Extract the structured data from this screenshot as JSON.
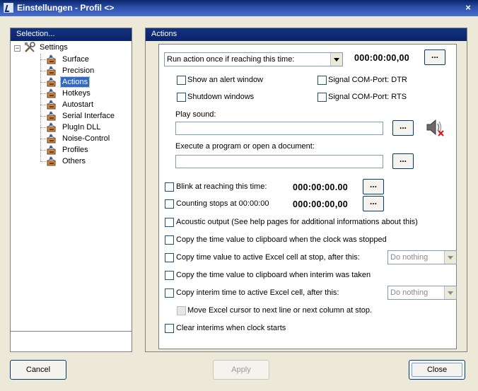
{
  "window": {
    "title": "Einstellungen - Profil <>",
    "close_glyph": "×"
  },
  "left_panel": {
    "header": "Selection...",
    "root": {
      "label": "Settings",
      "icon": "tools-icon",
      "expander": "−"
    },
    "items": [
      {
        "label": "Surface",
        "selected": false
      },
      {
        "label": "Precision",
        "selected": false
      },
      {
        "label": "Actions",
        "selected": true
      },
      {
        "label": "Hotkeys",
        "selected": false
      },
      {
        "label": "Autostart",
        "selected": false
      },
      {
        "label": "Serial Interface",
        "selected": false
      },
      {
        "label": "PlugIn DLL",
        "selected": false
      },
      {
        "label": "Noise-Control",
        "selected": false
      },
      {
        "label": "Profiles",
        "selected": false
      },
      {
        "label": "Others",
        "selected": false
      }
    ]
  },
  "right_panel": {
    "header": "Actions",
    "run_action": {
      "value": "Run action once if reaching this time:",
      "time": "000:00:00,00",
      "browse": "..."
    },
    "show_alert": {
      "label": "Show an alert window",
      "checked": false
    },
    "shutdown": {
      "label": "Shutdown windows",
      "checked": false
    },
    "signal_dtr": {
      "label": "Signal COM-Port: DTR",
      "checked": false
    },
    "signal_rts": {
      "label": "Signal COM-Port: RTS",
      "checked": false
    },
    "play_sound": {
      "label": "Play sound:",
      "value": "",
      "browse": "..."
    },
    "execute": {
      "label": "Execute a program or open a document:",
      "value": "",
      "browse": "..."
    },
    "blink": {
      "label": "Blink at reaching this time:",
      "time": "000:00:00.00",
      "browse": "..."
    },
    "counting_stops": {
      "label": "Counting stops at 00:00:00",
      "time": "000:00:00,00",
      "browse": "..."
    },
    "acoustic": {
      "label": "Acoustic output (See help pages for additional informations about this)"
    },
    "copy_clipboard_stop": {
      "label": "Copy the time value to clipboard when the clock was stopped"
    },
    "copy_excel_stop": {
      "label": "Copy time value to active Excel cell at stop, after this:",
      "select": "Do nothing"
    },
    "copy_clipboard_interim": {
      "label": "Copy the time value to clipboard when interim was taken"
    },
    "copy_excel_interim": {
      "label": "Copy interim time to active Excel cell, after this:",
      "select": "Do nothing"
    },
    "move_cursor": {
      "label": "Move Excel cursor to next line or next column at stop."
    },
    "clear_interims": {
      "label": "Clear interims when clock starts"
    }
  },
  "buttons": {
    "cancel": "Cancel",
    "apply": "Apply",
    "close": "Close"
  },
  "colors": {
    "title_bar": "#0a246a",
    "selection": "#316ac5",
    "mute_x": "#e01010"
  }
}
